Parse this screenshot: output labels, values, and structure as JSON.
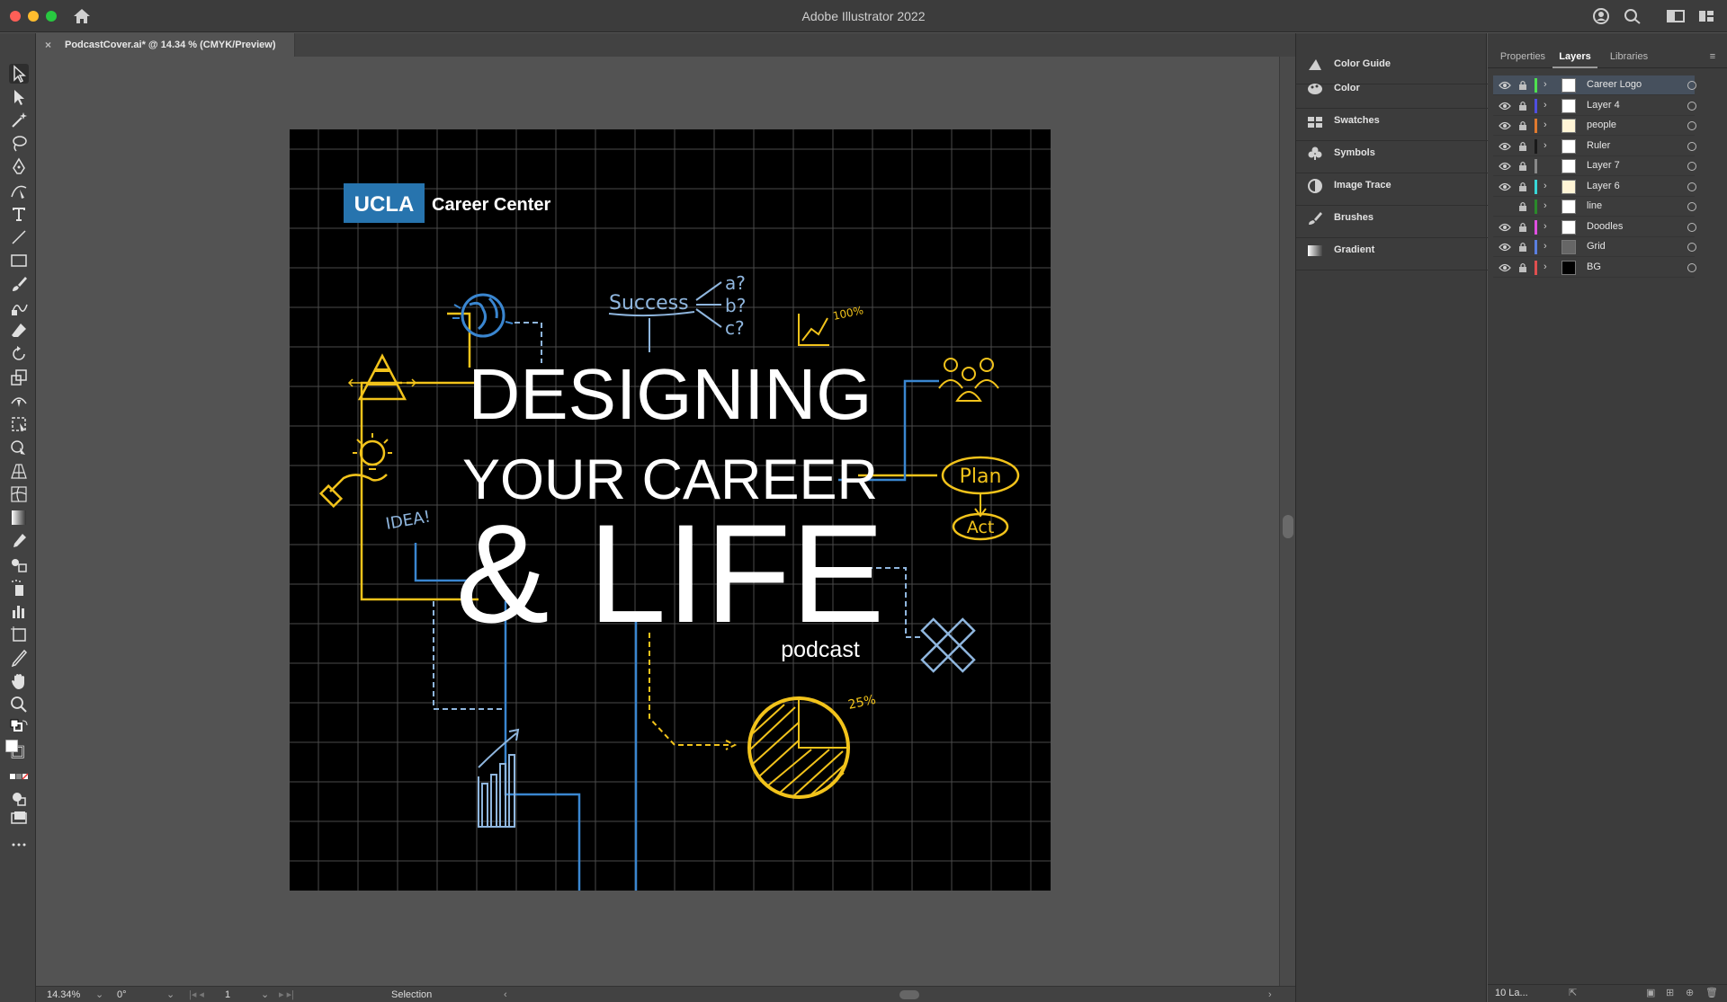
{
  "app": {
    "title": "Adobe Illustrator 2022"
  },
  "document_tab": {
    "name": "PodcastCover.ai* @ 14.34 % (CMYK/Preview)",
    "close": "×"
  },
  "artwork": {
    "logo_box": "UCLA",
    "logo_text": "Career Center",
    "headline_1": "DESIGNING",
    "headline_2": "YOUR CAREER",
    "headline_3": "& LIFE",
    "subline": "podcast",
    "doodle_success": "Success",
    "doodle_a": "a?",
    "doodle_b": "b?",
    "doodle_c": "c?",
    "doodle_100": "100%",
    "doodle_idea": "IDEA!",
    "doodle_plan": "Plan",
    "doodle_act": "Act",
    "doodle_25": "25%",
    "colors": {
      "yellow": "#f2c31b",
      "blue": "#3a86d0",
      "lightblue": "#8fb6de",
      "grid": "#555555"
    }
  },
  "status_bar": {
    "zoom": "14.34%",
    "rotation": "0°",
    "artboard": "1",
    "tool": "Selection"
  },
  "mid_panel": {
    "items": [
      {
        "label": "Color Guide",
        "icon": "color-guide-icon"
      },
      {
        "label": "Color",
        "icon": "palette-icon"
      },
      {
        "label": "Swatches",
        "icon": "swatches-icon"
      },
      {
        "label": "Symbols",
        "icon": "club-icon"
      },
      {
        "label": "Image Trace",
        "icon": "image-trace-icon"
      },
      {
        "label": "Brushes",
        "icon": "brush-icon"
      },
      {
        "label": "Gradient",
        "icon": "gradient-icon"
      }
    ]
  },
  "right_panel": {
    "tabs": [
      "Properties",
      "Layers",
      "Libraries"
    ],
    "layers": [
      {
        "name": "Career Logo",
        "color": "#4fe04f",
        "eye": true,
        "expand": true,
        "thumb": "#ffffff",
        "selected": true
      },
      {
        "name": "Layer 4",
        "color": "#4f4fe0",
        "eye": true,
        "expand": true,
        "thumb": "#ffffff",
        "selected": false
      },
      {
        "name": "people",
        "color": "#e07a2f",
        "eye": true,
        "expand": true,
        "thumb": "#fff5d6",
        "selected": false
      },
      {
        "name": "Ruler",
        "color": "#1a1a1a",
        "eye": true,
        "expand": true,
        "thumb": "#ffffff",
        "selected": false
      },
      {
        "name": "Layer 7",
        "color": "#888888",
        "eye": true,
        "expand": false,
        "thumb": "#ffffff",
        "selected": false
      },
      {
        "name": "Layer 6",
        "color": "#37d6d6",
        "eye": true,
        "expand": true,
        "thumb": "#fff5d6",
        "selected": false
      },
      {
        "name": "line",
        "color": "#2a8a2a",
        "eye": false,
        "expand": true,
        "thumb": "#ffffff",
        "selected": false
      },
      {
        "name": "Doodles",
        "color": "#e04fe0",
        "eye": true,
        "expand": true,
        "thumb": "#ffffff",
        "selected": false
      },
      {
        "name": "Grid",
        "color": "#5a7fe0",
        "eye": true,
        "expand": true,
        "thumb": "#666666",
        "selected": false
      },
      {
        "name": "BG",
        "color": "#e04f4f",
        "eye": true,
        "expand": true,
        "thumb": "#000000",
        "selected": false
      }
    ],
    "footer": "10 La..."
  }
}
